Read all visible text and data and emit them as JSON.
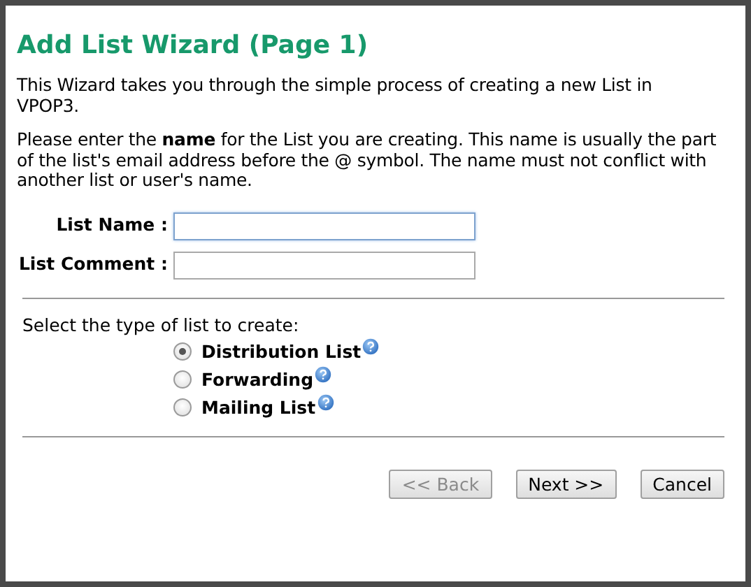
{
  "title": "Add List Wizard (Page 1)",
  "intro": "This Wizard takes you through the simple process of creating a new List in VPOP3.",
  "instructions": "Please enter the **name** for the List you are creating. This name is usually the part of the list's email address before the @ symbol. The name must not conflict with another list or user's name.",
  "fields": [
    {
      "label": "List Name :",
      "focused": true
    },
    {
      "label": "List Comment :",
      "focused": false
    }
  ],
  "list_type": {
    "prompt": "Select the type of list to create:",
    "options": [
      {
        "label": "Distribution List",
        "selected": true
      },
      {
        "label": "Forwarding",
        "selected": false
      },
      {
        "label": "Mailing List",
        "selected": false
      }
    ]
  },
  "buttons": [
    {
      "label": "<< Back",
      "disabled": true
    },
    {
      "label": "Next >>",
      "disabled": false
    },
    {
      "label": "Cancel",
      "disabled": false
    }
  ]
}
